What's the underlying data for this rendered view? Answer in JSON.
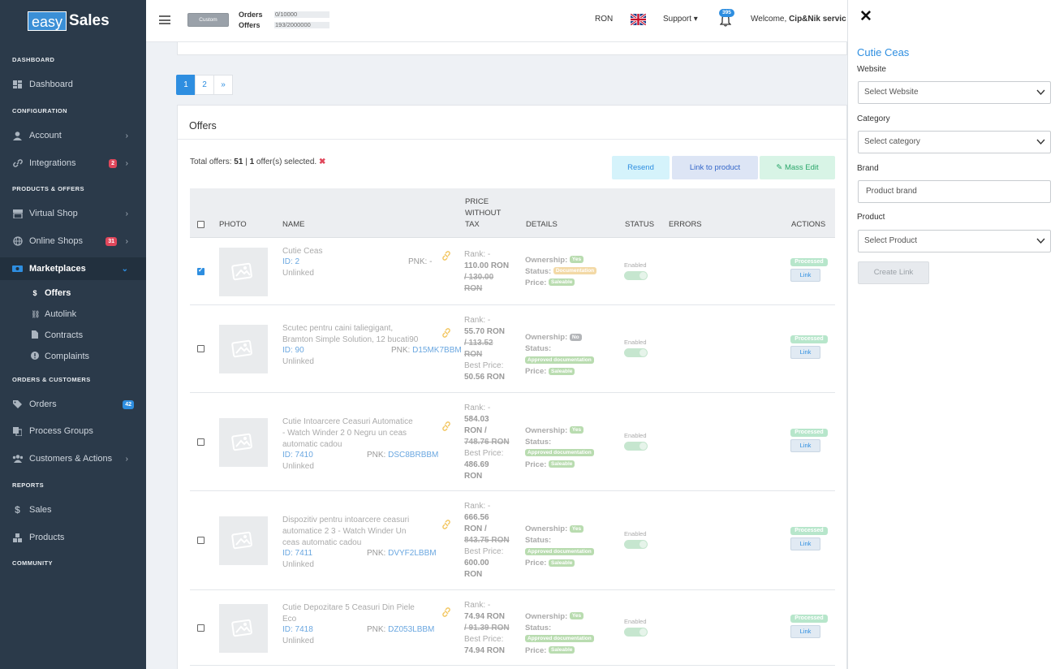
{
  "sidebar": {
    "logo": {
      "part1": "easy",
      "part2": "Sales"
    },
    "sections": {
      "dashboard": "DASHBOARD",
      "configuration": "CONFIGURATION",
      "products_offers": "PRODUCTS & OFFERS",
      "orders_customers": "ORDERS & CUSTOMERS",
      "reports": "REPORTS",
      "community": "COMMUNITY"
    },
    "items": {
      "dashboard": "Dashboard",
      "account": "Account",
      "integrations": "Integrations",
      "integrations_badge": "2",
      "virtual_shop": "Virtual Shop",
      "online_shops": "Online Shops",
      "online_shops_badge": "31",
      "marketplaces": "Marketplaces",
      "offers": "Offers",
      "autolink": "Autolink",
      "contracts": "Contracts",
      "complaints": "Complaints",
      "orders": "Orders",
      "orders_badge": "42",
      "process_groups": "Process Groups",
      "customers_actions": "Customers & Actions",
      "sales": "Sales",
      "products": "Products"
    }
  },
  "topbar": {
    "custom_btn": "Custom",
    "orders_label": "Orders",
    "orders_value": "0/10000",
    "offers_label": "Offers",
    "offers_value": "193/2000000",
    "currency": "RON",
    "support": "Support ▾",
    "notifications": "395",
    "welcome_prefix": "Welcome, ",
    "welcome_user": "Cip&Nik servic"
  },
  "pagination": [
    "1",
    "2",
    "»"
  ],
  "offers": {
    "title": "Offers",
    "total_prefix": "Total offers: ",
    "total_count": "51",
    "sep": " | ",
    "selected_count": "1",
    "selected_suffix": " offer(s) selected.",
    "clear": "✖",
    "buttons": {
      "resend": "Resend",
      "link": "Link to product",
      "mass_edit": "Mass Edit"
    },
    "columns": {
      "photo": "PHOTO",
      "name": "NAME",
      "price1": "PRICE",
      "price2": "WITHOUT",
      "price3": "TAX",
      "details": "DETAILS",
      "status": "STATUS",
      "errors": "ERRORS",
      "actions": "ACTIONS"
    },
    "labels": {
      "rank": "Rank: -",
      "best_price": "Best Price:",
      "ownership": "Ownership:",
      "status": "Status:",
      "price": "Price:",
      "enabled": "Enabled",
      "processed": "Processed",
      "link": "Link",
      "unlinked": "Unlinked",
      "pnk": "PNK: ",
      "saleable": "Saleable"
    },
    "rows": [
      {
        "checked": true,
        "name": [
          "Cutie Ceas"
        ],
        "id": "ID: 2",
        "pnk": "-",
        "price_lines": [
          "110.00 RON",
          "/ 130.00",
          "RON"
        ],
        "best": [],
        "ownership": "Yes",
        "status_pill": "Documentation",
        "status_color": "y"
      },
      {
        "checked": false,
        "name": [
          "Scutec pentru caini taliegigant,",
          "Bramton Simple Solution, 12 bucati90"
        ],
        "id": "ID: 90",
        "pnk": "D15MK7BBM",
        "price_lines": [
          "55.70 RON",
          "/ 113.52",
          "RON"
        ],
        "best": [
          "50.56 RON"
        ],
        "ownership": "No",
        "status_pill": "Approved documentation",
        "status_color": "g"
      },
      {
        "checked": false,
        "name": [
          "Cutie Intoarcere Ceasuri Automatice",
          "- Watch Winder 2 0 Negru un ceas",
          "automatic cadou"
        ],
        "id": "ID: 7410",
        "pnk": "DSC8BRBBM",
        "price_lines": [
          "584.03",
          "RON /",
          "748.76 RON"
        ],
        "best": [
          "486.69",
          "RON"
        ],
        "ownership": "Yes",
        "status_pill": "Approved documentation",
        "status_color": "g"
      },
      {
        "checked": false,
        "name": [
          "Dispozitiv pentru intoarcere ceasuri",
          "automatice 2 3 - Watch Winder Un",
          "ceas automatic cadou"
        ],
        "id": "ID: 7411",
        "pnk": "DVYF2LBBM",
        "price_lines": [
          "666.56",
          "RON /",
          "843.75 RON"
        ],
        "best": [
          "600.00",
          "RON"
        ],
        "ownership": "Yes",
        "status_pill": "Approved documentation",
        "status_color": "g"
      },
      {
        "checked": false,
        "name": [
          "Cutie Depozitare 5 Ceasuri Din Piele",
          "Eco"
        ],
        "id": "ID: 7418",
        "pnk": "DZ053LBBM",
        "price_lines": [
          "74.94 RON",
          "/ 91.39 RON"
        ],
        "best": [
          "74.94 RON"
        ],
        "ownership": "Yes",
        "status_pill": "Approved documentation",
        "status_color": "g"
      }
    ]
  },
  "panel": {
    "close": "✕",
    "title": "Cutie Ceas",
    "website_label": "Website",
    "website_placeholder": "Select Website",
    "category_label": "Category",
    "category_placeholder": "Select category",
    "brand_label": "Brand",
    "brand_placeholder": "Product brand",
    "product_label": "Product",
    "product_placeholder": "Select Product",
    "create_link": "Create Link"
  }
}
